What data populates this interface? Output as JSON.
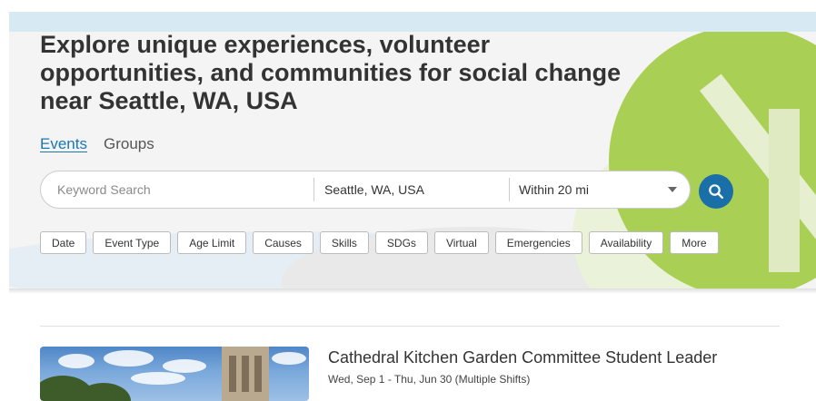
{
  "hero": {
    "title": "Explore unique experiences, volunteer opportunities, and communities for social change near Seattle, WA, USA"
  },
  "tabs": [
    {
      "label": "Events",
      "active": true
    },
    {
      "label": "Groups",
      "active": false
    }
  ],
  "search": {
    "keyword_placeholder": "Keyword Search",
    "keyword_value": "",
    "location": "Seattle, WA, USA",
    "distance": "Within 20 mi",
    "button_icon": "search-icon"
  },
  "filters": [
    "Date",
    "Event Type",
    "Age Limit",
    "Causes",
    "Skills",
    "SDGs",
    "Virtual",
    "Emergencies",
    "Availability",
    "More"
  ],
  "events": [
    {
      "title": "Cathedral Kitchen Garden Committee Student Leader",
      "date": "Wed, Sep 1 - Thu, Jun 30 (Multiple Shifts)"
    }
  ],
  "colors": {
    "accent": "#1a6fa8",
    "link": "#1a77b2",
    "deco_green": "#a9cf55"
  }
}
